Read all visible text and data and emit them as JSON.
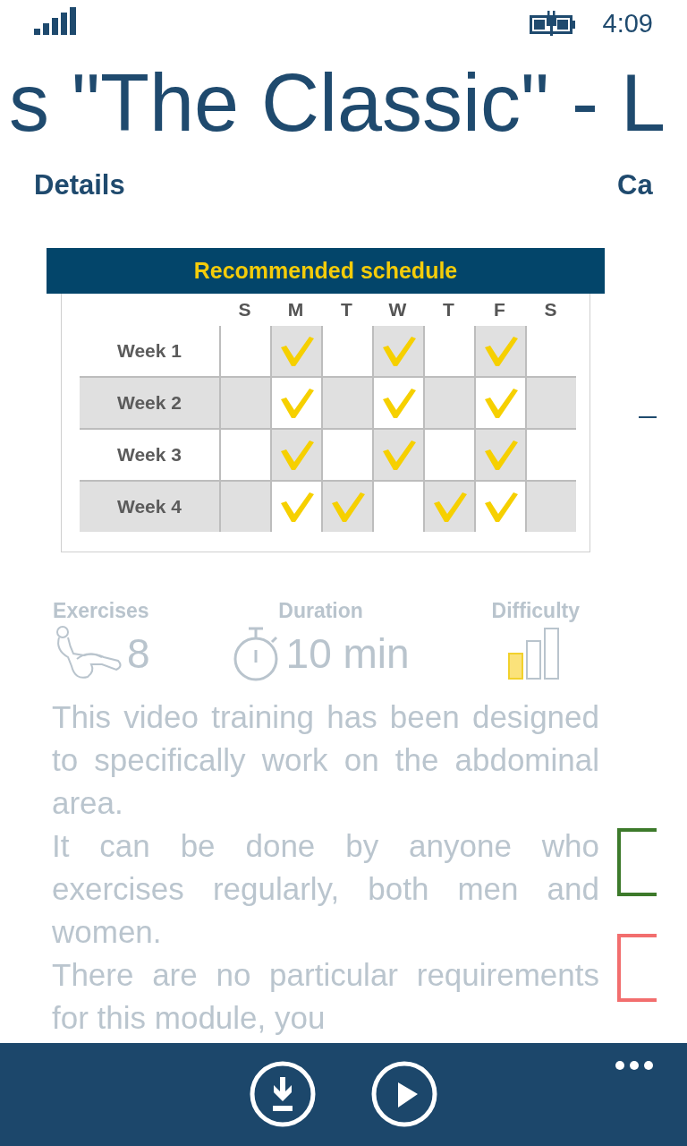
{
  "status_bar": {
    "time": "4:09"
  },
  "title": "s \"The Classic\" - L",
  "pivot": [
    "Details",
    "Ca"
  ],
  "schedule": {
    "title": "Recommended schedule",
    "days": [
      "S",
      "M",
      "T",
      "W",
      "T",
      "F",
      "S"
    ],
    "weeks": [
      {
        "label": "Week 1",
        "cells": [
          {
            "checked": false,
            "shaded": false
          },
          {
            "checked": true,
            "shaded": true
          },
          {
            "checked": false,
            "shaded": false
          },
          {
            "checked": true,
            "shaded": true
          },
          {
            "checked": false,
            "shaded": false
          },
          {
            "checked": true,
            "shaded": true
          },
          {
            "checked": false,
            "shaded": false
          }
        ]
      },
      {
        "label": "Week 2",
        "cells": [
          {
            "checked": false,
            "shaded": true
          },
          {
            "checked": true,
            "shaded": false
          },
          {
            "checked": false,
            "shaded": true
          },
          {
            "checked": true,
            "shaded": false
          },
          {
            "checked": false,
            "shaded": true
          },
          {
            "checked": true,
            "shaded": false
          },
          {
            "checked": false,
            "shaded": true
          }
        ]
      },
      {
        "label": "Week 3",
        "cells": [
          {
            "checked": false,
            "shaded": false
          },
          {
            "checked": true,
            "shaded": true
          },
          {
            "checked": false,
            "shaded": false
          },
          {
            "checked": true,
            "shaded": true
          },
          {
            "checked": false,
            "shaded": false
          },
          {
            "checked": true,
            "shaded": true
          },
          {
            "checked": false,
            "shaded": false
          }
        ]
      },
      {
        "label": "Week 4",
        "cells": [
          {
            "checked": false,
            "shaded": true
          },
          {
            "checked": true,
            "shaded": false
          },
          {
            "checked": true,
            "shaded": true
          },
          {
            "checked": false,
            "shaded": false
          },
          {
            "checked": true,
            "shaded": true
          },
          {
            "checked": true,
            "shaded": false
          },
          {
            "checked": false,
            "shaded": true
          }
        ]
      }
    ]
  },
  "stats": [
    {
      "kind": "exercises",
      "label": "Exercises",
      "value": "8"
    },
    {
      "kind": "duration",
      "label": "Duration",
      "value": "10 min"
    },
    {
      "kind": "difficulty",
      "label": "Difficulty",
      "level": 0.33
    }
  ],
  "description": [
    "This video training has been designed to specifically work on the abdominal area.",
    "It can be done by anyone who exercises regularly, both men and women.",
    "There are no particular requirements for this module, you"
  ],
  "side_panel": {
    "boxes": [
      {
        "color": "#3d7a2b"
      },
      {
        "color": "#f26e6e"
      }
    ]
  },
  "app_bar": {
    "buttons": [
      {
        "kind": "download"
      },
      {
        "kind": "play"
      }
    ]
  }
}
